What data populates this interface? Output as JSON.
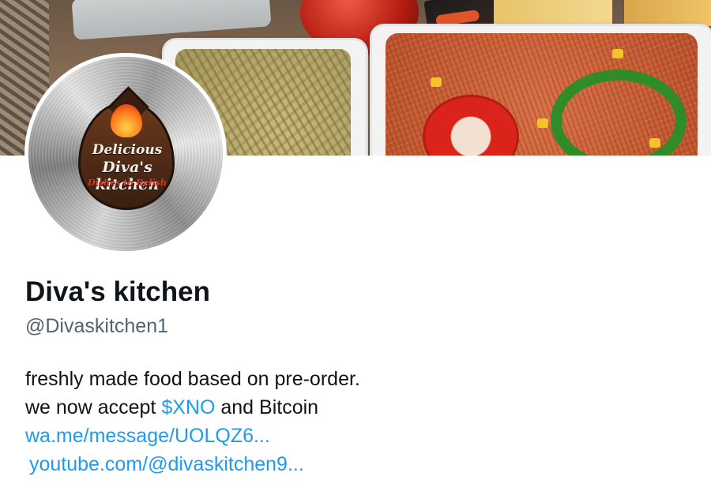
{
  "profile": {
    "name": "Diva's kitchen",
    "handle": "@Divaskitchen1",
    "avatar": {
      "logo_line1": "Delicious",
      "logo_line2": "Diva's kitchen",
      "logo_line3": "Dishes to Relish"
    }
  },
  "bio": {
    "line1": "freshly made food based on pre-order.",
    "line2_prefix": "we now accept ",
    "cashtag": "$XNO",
    "line2_suffix": " and Bitcoin",
    "link1": "wa.me/message/UOLQZ6...",
    "link2": "youtube.com/@divaskitchen9..."
  },
  "colors": {
    "link": "#1d9bf0",
    "text": "#0f1419",
    "secondary": "#536471"
  }
}
